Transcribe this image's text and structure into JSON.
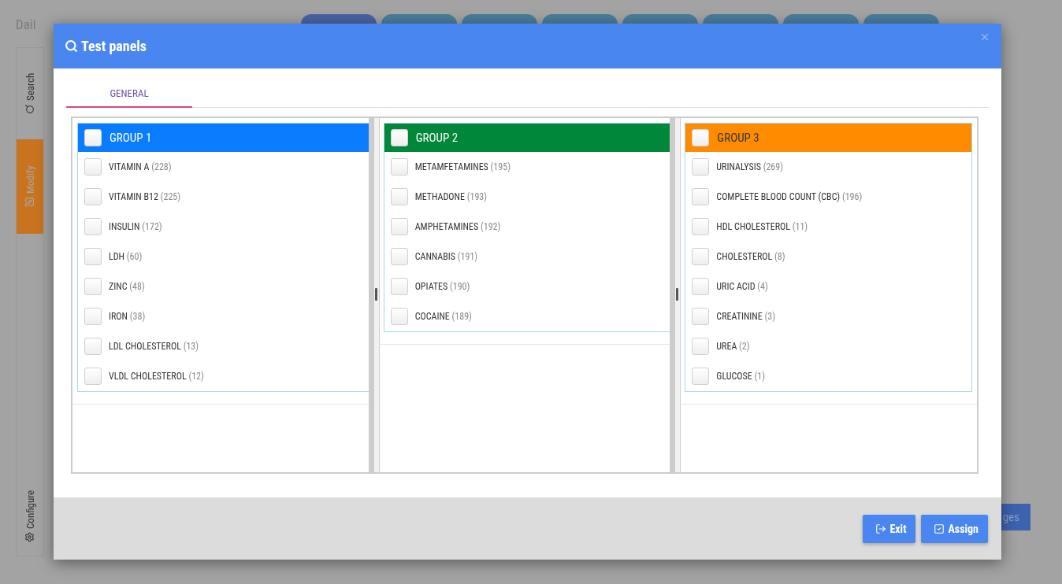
{
  "background": {
    "title": "Dail",
    "sidebar_tabs": [
      {
        "label": "Search",
        "kind": "search",
        "selected": false
      },
      {
        "label": "Modify",
        "kind": "modify",
        "selected": true
      },
      {
        "label": "Configure",
        "kind": "configure",
        "selected": false
      }
    ],
    "partial_button": "ges"
  },
  "dialog": {
    "title": "Test panels",
    "tabs": [
      {
        "label": "GENERAL",
        "selected": true
      }
    ],
    "groups": [
      {
        "title": "GROUP 1",
        "color": "#0a7cff",
        "checked": false,
        "items": [
          {
            "name": "VITAMIN A",
            "count": "(228)",
            "checked": false
          },
          {
            "name": "VITAMIN B12",
            "count": "(225)",
            "checked": false
          },
          {
            "name": "INSULIN",
            "count": "(172)",
            "checked": false
          },
          {
            "name": "LDH",
            "count": "(60)",
            "checked": false
          },
          {
            "name": "ZINC",
            "count": "(48)",
            "checked": false
          },
          {
            "name": "IRON",
            "count": "(38)",
            "checked": false
          },
          {
            "name": "LDL CHOLESTEROL",
            "count": "(13)",
            "checked": false
          },
          {
            "name": "VLDL CHOLESTEROL",
            "count": "(12)",
            "checked": false
          }
        ]
      },
      {
        "title": "GROUP 2",
        "color": "#00873a",
        "checked": false,
        "items": [
          {
            "name": "METAMFETAMINES",
            "count": "(195)",
            "checked": false
          },
          {
            "name": "METHADONE",
            "count": "(193)",
            "checked": false
          },
          {
            "name": "AMPHETAMINES",
            "count": "(192)",
            "checked": false
          },
          {
            "name": "CANNABIS",
            "count": "(191)",
            "checked": false
          },
          {
            "name": "OPIATES",
            "count": "(190)",
            "checked": false
          },
          {
            "name": "COCAINE",
            "count": "(189)",
            "checked": false
          }
        ]
      },
      {
        "title": "GROUP 3",
        "color": "#ff8c00",
        "checked": false,
        "items": [
          {
            "name": "URINALYSIS",
            "count": "(269)",
            "checked": false
          },
          {
            "name": "COMPLETE BLOOD COUNT (CBC)",
            "count": "(196)",
            "checked": false
          },
          {
            "name": "HDL CHOLESTEROL",
            "count": "(11)",
            "checked": false
          },
          {
            "name": "CHOLESTEROL",
            "count": "(8)",
            "checked": false
          },
          {
            "name": "URIC ACID",
            "count": "(4)",
            "checked": false
          },
          {
            "name": "CREATININE",
            "count": "(3)",
            "checked": false
          },
          {
            "name": "UREA",
            "count": "(2)",
            "checked": false
          },
          {
            "name": "GLUCOSE",
            "count": "(1)",
            "checked": false
          }
        ]
      }
    ],
    "buttons": [
      {
        "label": "Exit",
        "kind": "exit"
      },
      {
        "label": "Assign",
        "kind": "assign"
      }
    ]
  }
}
